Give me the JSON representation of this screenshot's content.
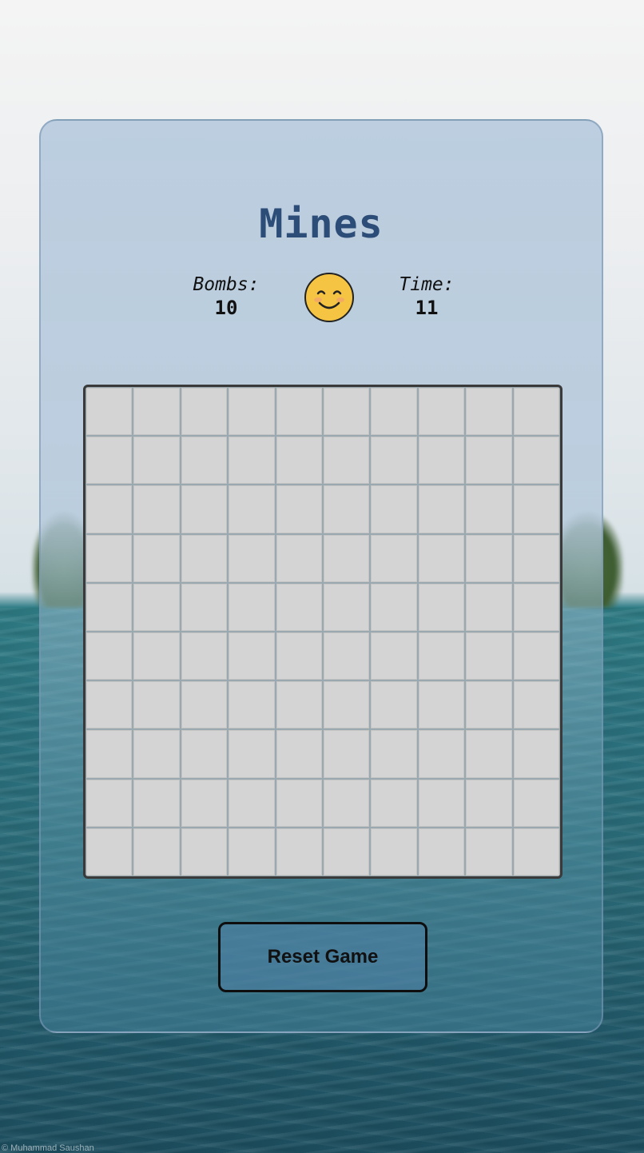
{
  "game": {
    "title": "Mines",
    "bombs_label": "Bombs:",
    "bombs_value": "10",
    "time_label": "Time:",
    "time_value": "11",
    "face_state": "smiling-face-icon",
    "reset_label": "Reset Game"
  },
  "board": {
    "rows": 10,
    "columns": 10,
    "cell_state": "unrevealed"
  },
  "background": {
    "credit": "© Muhammad Saushan"
  },
  "colors": {
    "title": "#2c4d78",
    "cell": "#d4d4d4",
    "face": "#f6c443"
  }
}
